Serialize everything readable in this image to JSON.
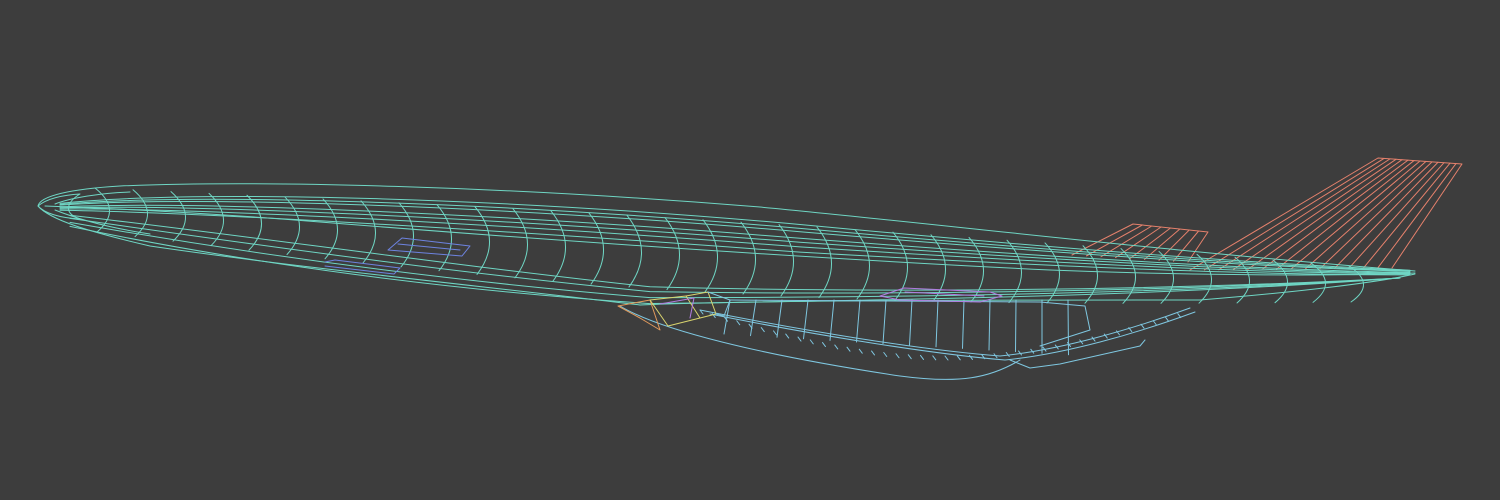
{
  "viewport": {
    "background": "#3d3d3d",
    "display_mode": "wireframe"
  },
  "model": {
    "object": "hypersonic-aircraft-wireframe",
    "parts": [
      {
        "name": "fuselage",
        "color": "#6fd6c4"
      },
      {
        "name": "underbody",
        "color": "#7fc7e0"
      },
      {
        "name": "vertical-tail",
        "color": "#e5816c"
      },
      {
        "name": "tail-fin",
        "color": "#e5816c"
      },
      {
        "name": "panel-blue",
        "color": "#6d83e0"
      },
      {
        "name": "panel-purple",
        "color": "#b27be0"
      },
      {
        "name": "intake-yellow",
        "color": "#d9d46e"
      },
      {
        "name": "intake-orange",
        "color": "#e19a5c"
      }
    ]
  }
}
